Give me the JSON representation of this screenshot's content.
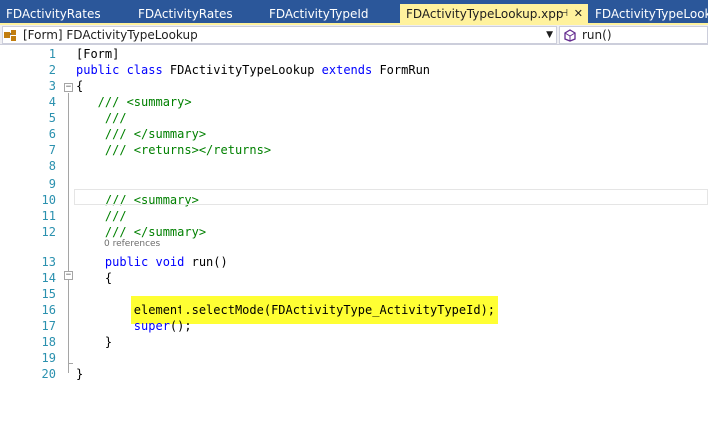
{
  "tabs": [
    {
      "label": "FDActivityRates"
    },
    {
      "label": "FDActivityRates"
    },
    {
      "label": "FDActivityTypeId"
    },
    {
      "label": "FDActivityTypeLookup.xpp",
      "active": true
    },
    {
      "label": "FDActivityTypeLookup"
    }
  ],
  "navbar": {
    "class_selector": "[Form] FDActivityTypeLookup",
    "method_selector": "run()"
  },
  "editor": {
    "references_label": "0 references",
    "lines": [
      {
        "n": "1",
        "tokens": [
          [
            "",
            "[Form]"
          ]
        ]
      },
      {
        "n": "2",
        "tokens": [
          [
            "kw",
            "public class"
          ],
          [
            "",
            " FDActivityTypeLookup "
          ],
          [
            "kw",
            "extends"
          ],
          [
            "",
            " FormRun"
          ]
        ]
      },
      {
        "n": "3",
        "tokens": [
          [
            "",
            "{"
          ]
        ]
      },
      {
        "n": "4",
        "tokens": [
          [
            "cm",
            "   /// <summary>"
          ]
        ]
      },
      {
        "n": "5",
        "tokens": [
          [
            "cm",
            "    ///"
          ]
        ]
      },
      {
        "n": "6",
        "tokens": [
          [
            "cm",
            "    /// </summary>"
          ]
        ]
      },
      {
        "n": "7",
        "tokens": [
          [
            "cm",
            "    /// <returns></returns>"
          ]
        ]
      },
      {
        "n": "8",
        "tokens": []
      },
      {
        "n": "9",
        "tokens": []
      },
      {
        "n": "10",
        "tokens": [
          [
            "cm",
            "    /// <summary>"
          ]
        ]
      },
      {
        "n": "11",
        "tokens": [
          [
            "cm",
            "    ///"
          ]
        ]
      },
      {
        "n": "12",
        "tokens": [
          [
            "cm",
            "    /// </summary>"
          ]
        ]
      },
      {
        "n": "13",
        "tokens": [
          [
            "kw",
            "    public void"
          ],
          [
            "",
            " run()"
          ]
        ]
      },
      {
        "n": "14",
        "tokens": [
          [
            "",
            "    {"
          ]
        ]
      },
      {
        "n": "15",
        "tokens": []
      },
      {
        "n": "16",
        "tokens": [
          [
            "",
            "        "
          ],
          [
            "hlkw",
            "element"
          ],
          [
            "hl",
            ".selectMode(FDActivityType_ActivityTypeId);"
          ]
        ]
      },
      {
        "n": "17",
        "tokens": [
          [
            "",
            "        "
          ],
          [
            "kw",
            "super"
          ],
          [
            "",
            "();"
          ]
        ]
      },
      {
        "n": "18",
        "tokens": [
          [
            "",
            "    }"
          ]
        ]
      },
      {
        "n": "19",
        "tokens": []
      },
      {
        "n": "20",
        "tokens": [
          [
            "",
            "}"
          ]
        ]
      }
    ]
  },
  "colors": {
    "tab_strip": "#2b579a",
    "active_tab": "#fff29d",
    "keyword": "#0000ff",
    "comment": "#008000",
    "line_number": "#2b91af",
    "highlight": "#ffff33"
  }
}
